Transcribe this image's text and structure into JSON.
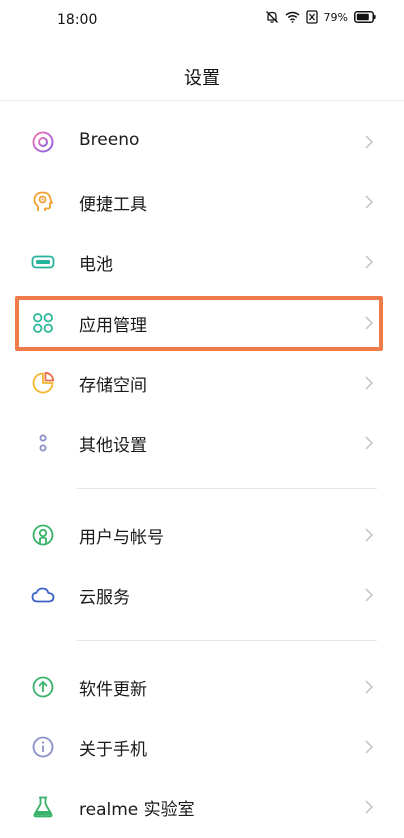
{
  "status_bar": {
    "time": "18:00",
    "battery_percent": "79%"
  },
  "header": {
    "title": "设置"
  },
  "items": [
    {
      "label": "Breeno",
      "icon": "breeno-icon"
    },
    {
      "label": "便捷工具",
      "icon": "tools-head-icon"
    },
    {
      "label": "电池",
      "icon": "battery-icon"
    },
    {
      "label": "应用管理",
      "icon": "apps-grid-icon"
    },
    {
      "label": "存储空间",
      "icon": "storage-pie-icon"
    },
    {
      "label": "其他设置",
      "icon": "more-dots-icon"
    },
    {
      "label": "用户与帐号",
      "icon": "user-icon"
    },
    {
      "label": "云服务",
      "icon": "cloud-icon"
    },
    {
      "label": "软件更新",
      "icon": "update-arrow-icon"
    },
    {
      "label": "关于手机",
      "icon": "info-icon"
    },
    {
      "label": "realme 实验室",
      "icon": "lab-flask-icon"
    }
  ],
  "highlight": {
    "target": "应用管理",
    "color": "#ee7b48"
  }
}
